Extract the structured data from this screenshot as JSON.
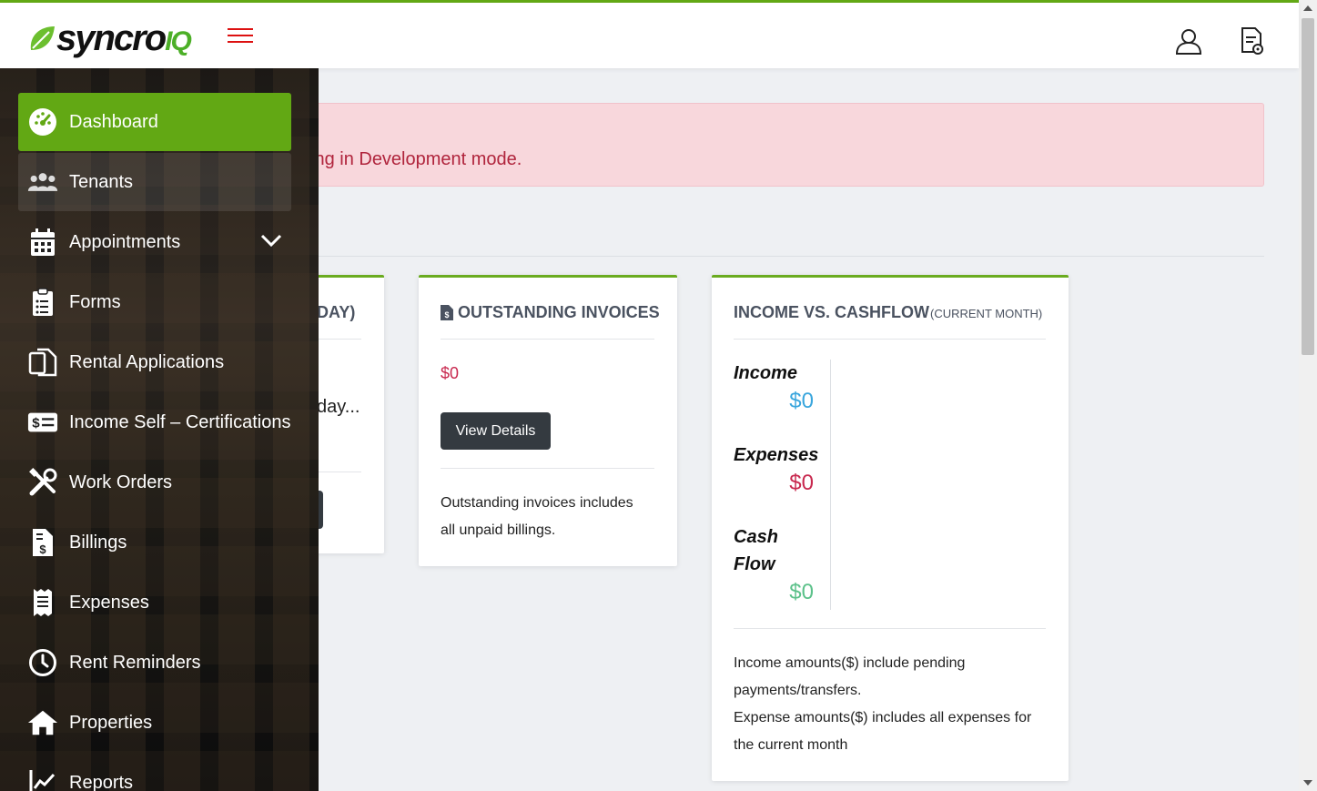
{
  "header": {
    "logo_text": "syncro",
    "logo_suffix": "IQ",
    "user_icon": "user-icon",
    "docs_icon": "document-settings-icon"
  },
  "alert": {
    "text": "ing in Development mode."
  },
  "cards": {
    "partial": {
      "title_fragment": "DAY)",
      "text_fragment": "day..."
    },
    "invoices": {
      "title": "OUTSTANDING INVOICES",
      "amount": "$0",
      "button": "View Details",
      "description_line1": "Outstanding invoices includes",
      "description_line2": "all unpaid billings."
    },
    "income": {
      "title": "INCOME VS. CASHFLOW",
      "subtitle": "(CURRENT MONTH)",
      "income_label": "Income",
      "income_value": "$0",
      "expenses_label": "Expenses",
      "expenses_value": "$0",
      "cashflow_label1": "Cash",
      "cashflow_label2": "Flow",
      "cashflow_value": "$0",
      "note_line1": "Income amounts($) include pending",
      "note_line2": "payments/transfers.",
      "note_line3": "Expense amounts($) includes all expenses for",
      "note_line4": "the current month"
    }
  },
  "sidebar": {
    "items": [
      {
        "label": "Dashboard",
        "icon": "gauge-icon"
      },
      {
        "label": "Tenants",
        "icon": "users-icon"
      },
      {
        "label": "Appointments",
        "icon": "calendar-icon"
      },
      {
        "label": "Forms",
        "icon": "clipboard-icon"
      },
      {
        "label": "Rental Applications",
        "icon": "copy-icon"
      },
      {
        "label": "Income Self – Certifications",
        "icon": "money-bill-icon"
      },
      {
        "label": "Work Orders",
        "icon": "tools-icon"
      },
      {
        "label": "Billings",
        "icon": "invoice-dollar-icon"
      },
      {
        "label": "Expenses",
        "icon": "receipt-icon"
      },
      {
        "label": "Rent Reminders",
        "icon": "clock-icon"
      },
      {
        "label": "Properties",
        "icon": "home-icon"
      },
      {
        "label": "Reports",
        "icon": "chart-line-icon"
      }
    ]
  },
  "colors": {
    "brand_green": "#62a814",
    "income_blue": "#3aa6dd",
    "expense_red": "#c8294f",
    "cashflow_green": "#5cc18a"
  }
}
